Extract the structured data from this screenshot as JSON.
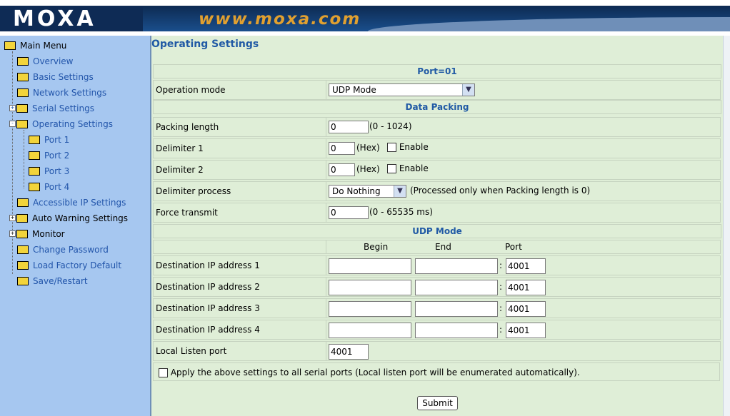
{
  "header": {
    "logo": "MOXA",
    "site": "www.moxa.com"
  },
  "tree": {
    "main_menu": "Main Menu",
    "items": [
      "Overview",
      "Basic Settings",
      "Network Settings",
      "Serial Settings",
      "Operating Settings",
      "Port 1",
      "Port 2",
      "Port 3",
      "Port 4",
      "Accessible IP Settings",
      "Auto Warning Settings",
      "Monitor",
      "Change Password",
      "Load Factory Default",
      "Save/Restart"
    ]
  },
  "page": {
    "title": "Operating Settings"
  },
  "form": {
    "port_header": "Port=01",
    "operation_mode_label": "Operation mode",
    "operation_mode_value": "UDP Mode",
    "data_packing_header": "Data Packing",
    "packing_length_label": "Packing length",
    "packing_length_value": "0",
    "packing_length_hint": "(0 - 1024)",
    "delimiter1_label": "Delimiter 1",
    "delimiter1_value": "0",
    "delimiter2_label": "Delimiter 2",
    "delimiter2_value": "0",
    "hex_hint": "(Hex)",
    "enable_label": "Enable",
    "delimiter_process_label": "Delimiter process",
    "delimiter_process_value": "Do Nothing",
    "delimiter_process_hint": "(Processed only when Packing length is 0)",
    "force_transmit_label": "Force transmit",
    "force_transmit_value": "0",
    "force_transmit_hint": "(0 - 65535 ms)",
    "udp_header": "UDP Mode",
    "col_begin": "Begin",
    "col_end": "End",
    "col_port": "Port",
    "dest_rows": [
      {
        "label": "Destination IP address 1",
        "begin": "",
        "end": "",
        "port": "4001"
      },
      {
        "label": "Destination IP address 2",
        "begin": "",
        "end": "",
        "port": "4001"
      },
      {
        "label": "Destination IP address 3",
        "begin": "",
        "end": "",
        "port": "4001"
      },
      {
        "label": "Destination IP address 4",
        "begin": "",
        "end": "",
        "port": "4001"
      }
    ],
    "colon": ":",
    "local_listen_label": "Local Listen port",
    "local_listen_value": "4001",
    "apply_all_label": "Apply the above settings to all serial ports (Local listen port will be enumerated automatically).",
    "submit_label": "Submit"
  }
}
